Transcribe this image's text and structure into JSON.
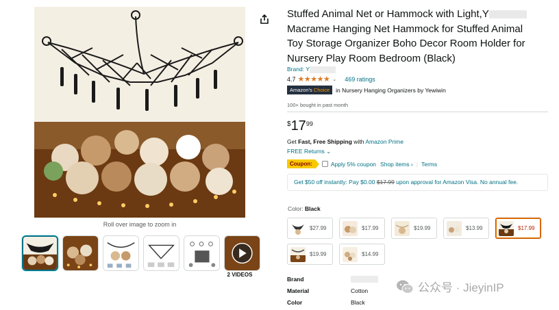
{
  "product": {
    "title_lines": [
      "Stuffed Animal Net or Hammock with Light,Y",
      "Macrame Hanging Net Hammock for Stuffed Animal",
      "Toy Storage Organizer Boho Decor Room Holder for",
      "Nursery Play Room Bedroom (Black)"
    ],
    "brand_prefix": "Brand: Y",
    "rating": "4.7",
    "ratings_count": "469 ratings",
    "choice_badge_left": "Amazon's",
    "choice_badge_right": "Choice",
    "choice_category_prefix": "in ",
    "choice_category": "Nursery Hanging Organizers by Yewiwin",
    "bought": "100+ bought in past month"
  },
  "price": {
    "symbol": "$",
    "whole": "17",
    "fraction": "99"
  },
  "shipping": {
    "prefix": "Get ",
    "bold": "Fast, Free Shipping",
    "mid": " with ",
    "link": "Amazon Prime",
    "returns": "FREE Returns"
  },
  "coupon": {
    "badge": "Coupon:",
    "apply": "Apply 5% coupon",
    "shop_items": "Shop items ›",
    "terms": "Terms"
  },
  "visa_offer": {
    "text_a": "Get $50 off instantly: Pay $0.00 ",
    "struck": "$17.99",
    "text_b": " upon approval for Amazon Visa. No annual fee."
  },
  "color": {
    "label": "Color: ",
    "value": "Black"
  },
  "swatches": [
    {
      "price": "$27.99",
      "selected": false
    },
    {
      "price": "$17.99",
      "selected": false
    },
    {
      "price": "$19.99",
      "selected": false
    },
    {
      "price": "$13.99",
      "selected": false
    },
    {
      "price": "$17.99",
      "selected": true
    },
    {
      "price": "$19.99",
      "selected": false
    },
    {
      "price": "$14.99",
      "selected": false
    }
  ],
  "specs": [
    {
      "key": "Brand",
      "value": ""
    },
    {
      "key": "Material",
      "value": "Cotton"
    },
    {
      "key": "Color",
      "value": "Black"
    }
  ],
  "gallery": {
    "rollover": "Roll over image to zoom in",
    "videos_label": "2 VIDEOS"
  },
  "watermark": "公众号 · JieyinIP",
  "colors": {
    "link": "#007185",
    "star": "#de7921",
    "coupon_bg": "#f7ca00",
    "choice_bg": "#232f3e",
    "selected_border": "#e77600"
  }
}
